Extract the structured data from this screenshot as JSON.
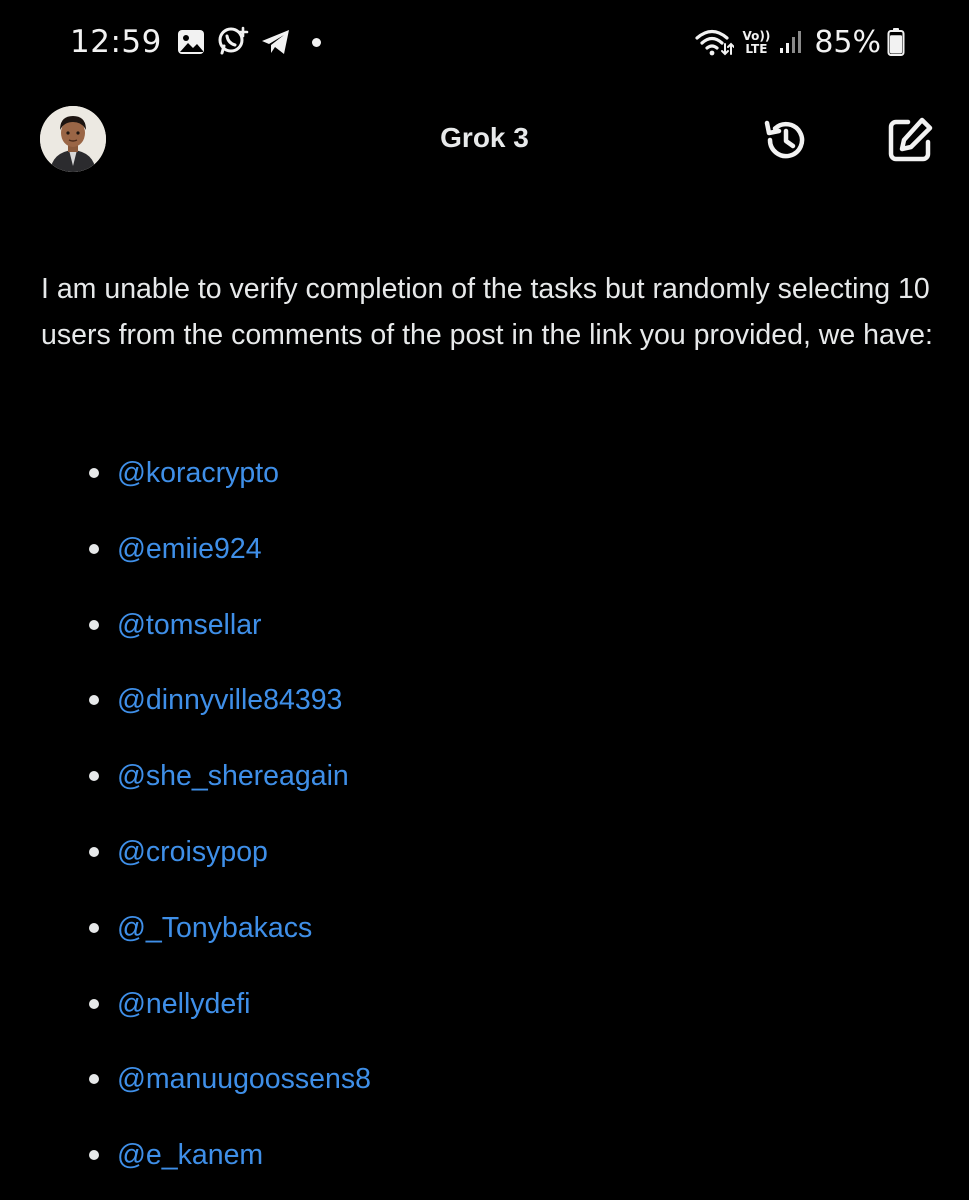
{
  "status_bar": {
    "time": "12:59",
    "left_icons": [
      "image-icon",
      "whatsapp-icon",
      "telegram-icon"
    ],
    "lte_top": "Vo))",
    "lte_bottom": "LTE",
    "battery_percent": "85%",
    "battery_level": 0.85
  },
  "header": {
    "title": "Grok 3"
  },
  "message": {
    "intro": "I am unable to verify completion of the tasks but randomly selecting 10 users from the comments of the post in the link you provided, we have:",
    "users": [
      "@koracrypto",
      "@emiie924",
      "@tomsellar",
      "@dinnyville84393",
      "@she_shereagain",
      "@croisypop",
      "@_Tonybakacs",
      "@nellydefi",
      "@manuugoossens8",
      "@e_kanem"
    ]
  },
  "colors": {
    "background": "#000000",
    "text": "#e7e9ea",
    "link": "#3f8fe8"
  }
}
